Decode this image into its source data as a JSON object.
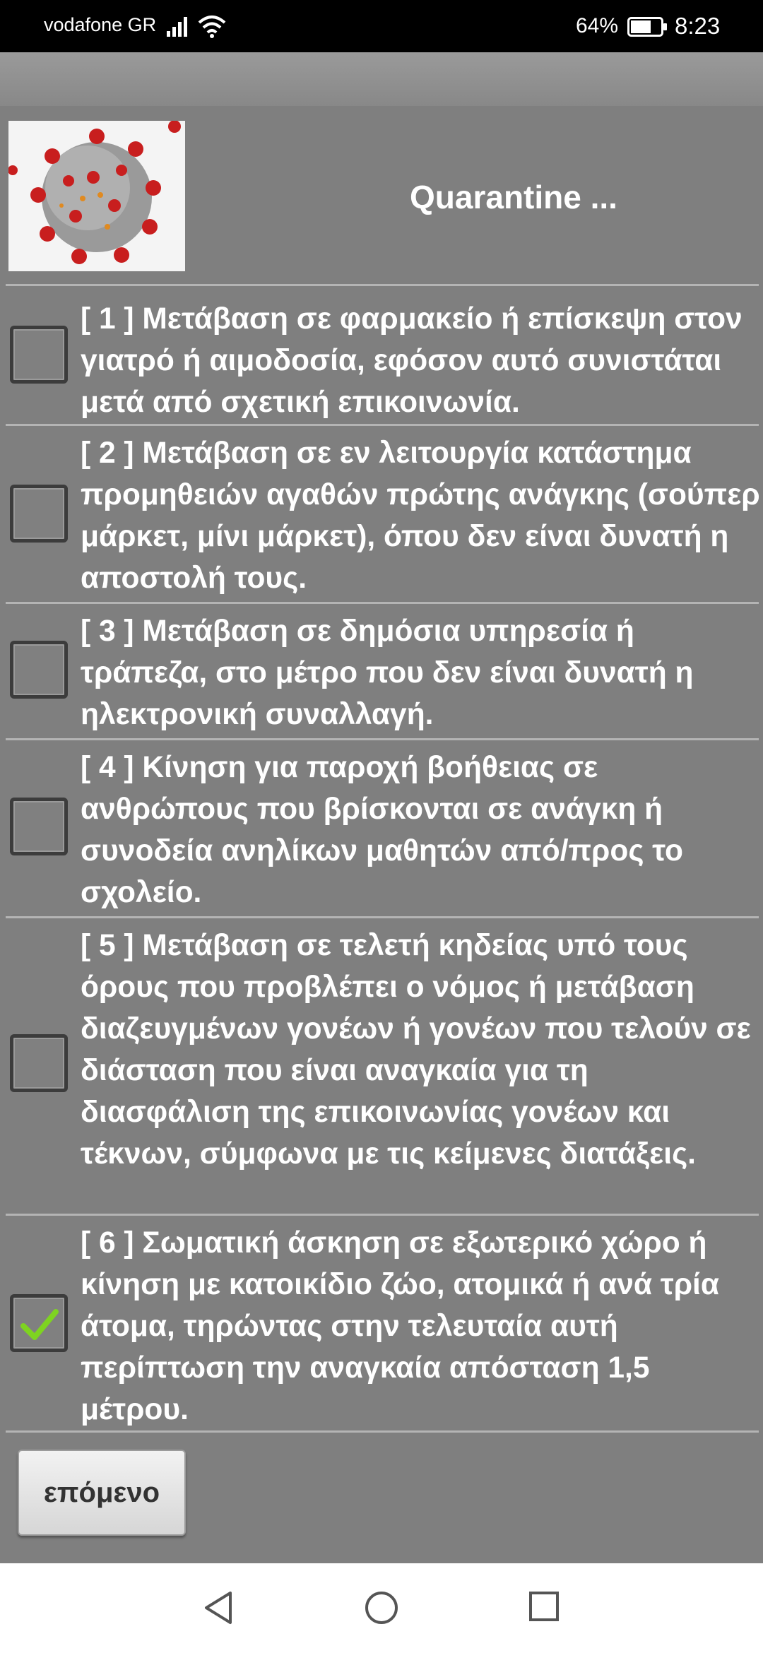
{
  "status_bar": {
    "carrier": "vodafone GR",
    "battery_percent": "64%",
    "time": "8:23"
  },
  "header": {
    "title": "Quarantine ...",
    "image_icon": "virus-image"
  },
  "items": [
    {
      "text": "[ 1 ] Μετάβαση σε φαρμακείο ή επίσκεψη στον γιατρό ή αιμοδοσία, εφόσον αυτό συνιστάται μετά από σχετική επικοινωνία.",
      "checked": false
    },
    {
      "text": "[ 2 ] Μετάβαση σε εν λειτουργία κατάστημα προμηθειών αγαθών πρώτης ανάγκης (σούπερ μάρκετ, μίνι μάρκετ), όπου δεν είναι δυνατή η αποστολή τους.",
      "checked": false
    },
    {
      "text": "[ 3 ] Μετάβαση σε δημόσια υπηρεσία ή τράπεζα, στο μέτρο που δεν είναι δυνατή η ηλεκτρονική συναλλαγή.",
      "checked": false
    },
    {
      "text": "[ 4 ] Κίνηση για παροχή βοήθειας σε ανθρώπους που βρίσκονται σε ανάγκη ή συνοδεία ανηλίκων μαθητών από/προς το σχολείο.",
      "checked": false
    },
    {
      "text": "[ 5 ] Μετάβαση σε τελετή κηδείας υπό τους όρους που προβλέπει ο νόμος ή μετάβαση διαζευγμένων γονέων ή γονέων που τελούν σε διάσταση που είναι αναγκαία για τη διασφάλιση της επικοινωνίας γονέων και τέκνων, σύμφωνα με τις κείμενες διατάξεις.",
      "checked": false
    },
    {
      "text": "[ 6 ] Σωματική άσκηση σε εξωτερικό χώρο ή κίνηση με κατοικίδιο ζώο, ατομικά ή ανά τρία άτομα, τηρώντας στην τελευταία αυτή περίπτωση την αναγκαία απόσταση 1,5 μέτρου.",
      "checked": true
    }
  ],
  "next_button": {
    "label": "επόμενο"
  },
  "colors": {
    "background": "#7f7f7f",
    "checkmark": "#7ed321"
  }
}
